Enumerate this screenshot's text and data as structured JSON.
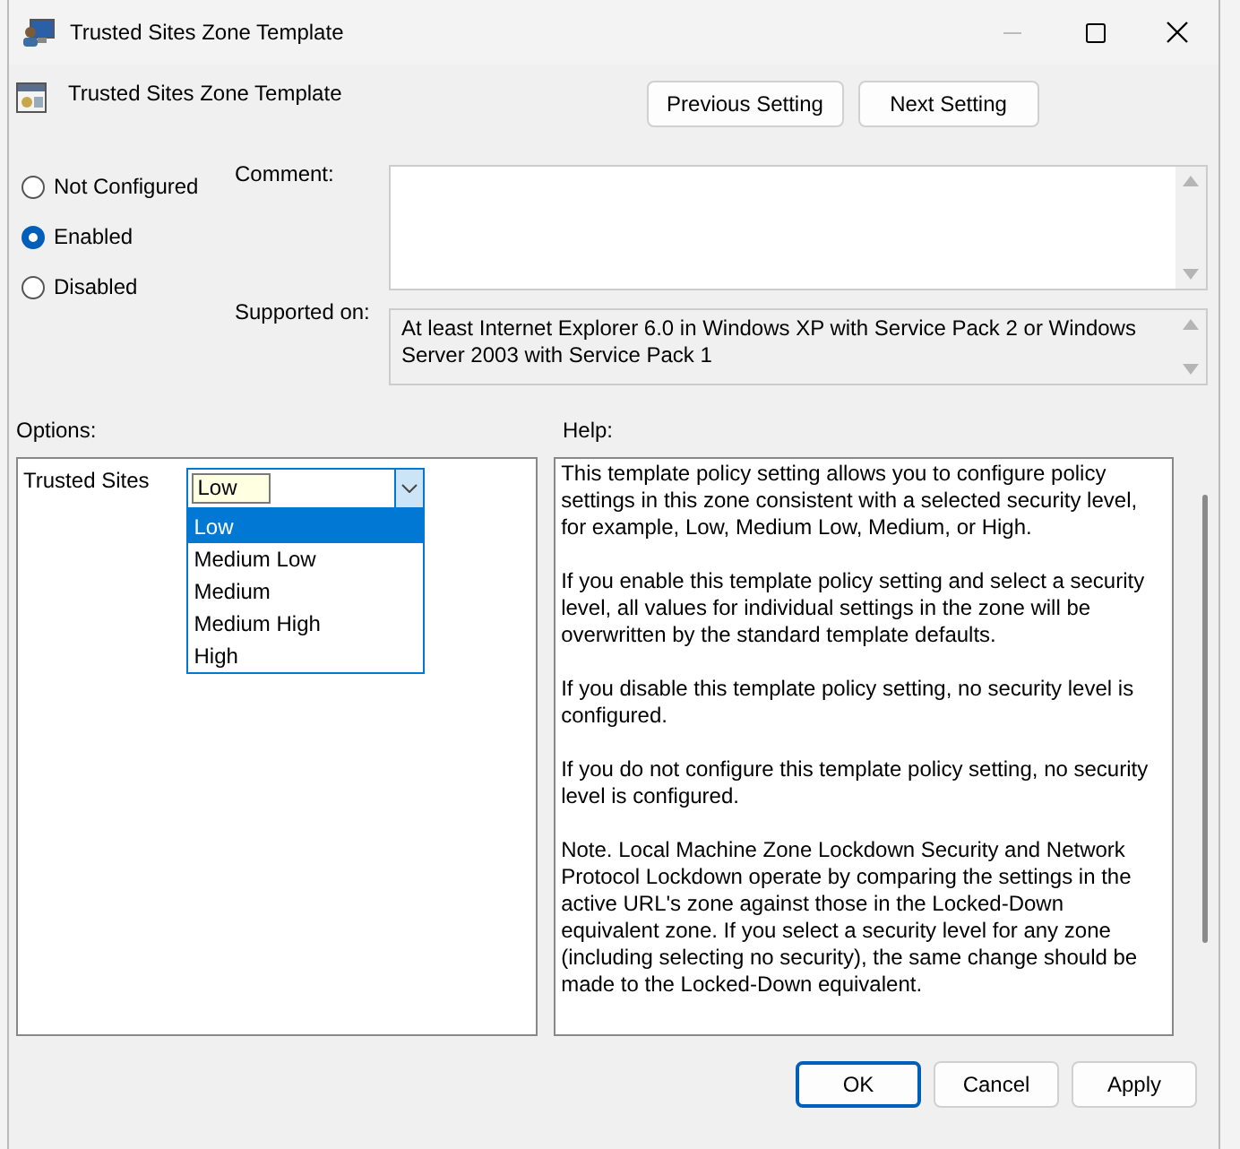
{
  "window": {
    "title": "Trusted Sites Zone Template"
  },
  "policy_title": "Trusted Sites Zone Template",
  "nav_buttons": [
    "Previous Setting",
    "Next Setting"
  ],
  "state_options": [
    {
      "label": "Not Configured",
      "selected": false
    },
    {
      "label": "Enabled",
      "selected": true
    },
    {
      "label": "Disabled",
      "selected": false
    }
  ],
  "comment": {
    "label": "Comment:"
  },
  "supported_on": {
    "label": "Supported on:",
    "value": "At least Internet Explorer 6.0 in Windows XP with Service Pack 2 or Windows Server 2003 with Service Pack 1"
  },
  "options": {
    "label": "Options:",
    "fields": [
      {
        "label": "Trusted Sites",
        "value": "Low",
        "expanded": true,
        "items": [
          {
            "label": "Low",
            "selected": true
          },
          {
            "label": "Medium Low",
            "selected": false
          },
          {
            "label": "Medium",
            "selected": false
          },
          {
            "label": "Medium High",
            "selected": false
          },
          {
            "label": "High",
            "selected": false
          }
        ]
      }
    ]
  },
  "help": {
    "label": "Help:",
    "paragraphs": [
      "This template policy setting allows you to configure policy settings in this zone consistent with a selected security level, for example, Low, Medium Low, Medium, or High.",
      "If you enable this template policy setting and select a security level, all values for individual settings in the zone will be overwritten by the standard template defaults.",
      "If you disable this template policy setting, no security level is configured.",
      "If you do not configure this template policy setting, no security level is configured.",
      "Note. Local Machine Zone Lockdown Security and Network Protocol Lockdown operate by comparing the settings in the active URL's zone against those in the Locked-Down equivalent zone. If you select a security level for any zone (including selecting no security), the same change should be made to the Locked-Down equivalent."
    ]
  },
  "buttons": [
    {
      "label": "OK",
      "default": true
    },
    {
      "label": "Cancel",
      "default": false
    },
    {
      "label": "Apply",
      "default": false
    }
  ]
}
